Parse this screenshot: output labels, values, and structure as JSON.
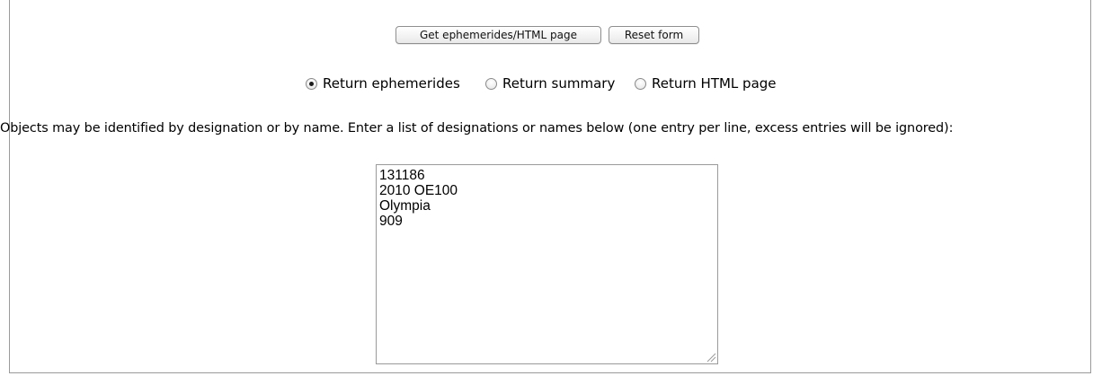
{
  "buttons": {
    "get_label": "Get ephemerides/HTML page",
    "reset_label": "Reset form"
  },
  "return_options": [
    {
      "label": "Return ephemerides",
      "selected": true
    },
    {
      "label": "Return summary",
      "selected": false
    },
    {
      "label": "Return HTML page",
      "selected": false
    }
  ],
  "instructions": "Objects may be identified by designation or by name. Enter a list of designations or names below (one entry per line, excess entries will be ignored):",
  "object_list": {
    "value": "131186\n2010 OE100\nOlympia\n909"
  },
  "icons": {
    "resize": "resize-grip-icon"
  }
}
